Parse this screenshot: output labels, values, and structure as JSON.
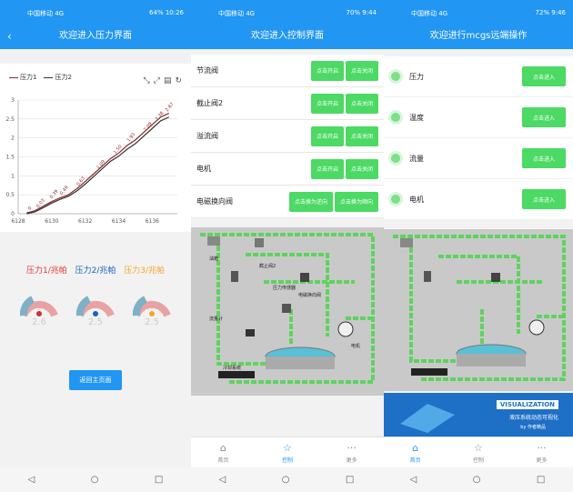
{
  "status": {
    "p1": {
      "left": "中国移动 4G",
      "right": "64% 10:26"
    },
    "p2": {
      "left": "中国移动 4G",
      "right": "70% 9:44"
    },
    "p3": {
      "left": "中国移动 4G",
      "right": "72% 9:46"
    }
  },
  "panel1": {
    "title": "欢迎进入压力界面",
    "legend": [
      "压力1",
      "压力2"
    ],
    "gauge_legend": [
      {
        "text": "压力1/兆帕",
        "color": "#e53935"
      },
      {
        "text": "压力2/兆帕",
        "color": "#1565c0"
      },
      {
        "text": "压力3/兆帕",
        "color": "#f5a623"
      }
    ],
    "gauge_values": [
      "2.6",
      "2.5",
      "2.5"
    ],
    "home_button": "返回主页面"
  },
  "chart_data": {
    "type": "line",
    "title": "",
    "xlabel": "",
    "ylabel": "",
    "xlim": [
      6128,
      6137.5
    ],
    "ylim": [
      0,
      3
    ],
    "x_ticks": [
      6128,
      6130,
      6132,
      6134,
      6136
    ],
    "y_ticks": [
      0,
      0.5,
      1,
      1.5,
      2,
      2.5,
      3
    ],
    "series": [
      {
        "name": "压力1",
        "color": "#8b2a2a",
        "x": [
          6128.5,
          6129,
          6129.5,
          6130,
          6130.5,
          6131,
          6131.5,
          6132,
          6132.5,
          6133,
          6133.5,
          6134,
          6134.5,
          6135,
          6135.5,
          6136,
          6136.5,
          6137
        ],
        "y": [
          0.02,
          0.08,
          0.2,
          0.32,
          0.42,
          0.5,
          0.66,
          0.85,
          1.05,
          1.25,
          1.45,
          1.6,
          1.8,
          1.95,
          2.15,
          2.35,
          2.55,
          2.65
        ]
      },
      {
        "name": "压力2",
        "color": "#333333",
        "x": [
          6128.5,
          6129,
          6129.5,
          6130,
          6130.5,
          6131,
          6131.5,
          6132,
          6132.5,
          6133,
          6133.5,
          6134,
          6134.5,
          6135,
          6135.5,
          6136,
          6136.5,
          6137
        ],
        "y": [
          0.0,
          0.05,
          0.16,
          0.28,
          0.38,
          0.46,
          0.6,
          0.78,
          0.98,
          1.18,
          1.38,
          1.52,
          1.7,
          1.85,
          2.05,
          2.25,
          2.45,
          2.55
        ]
      }
    ],
    "data_labels": [
      {
        "x": 6128.7,
        "y": 0.02,
        "text": "0"
      },
      {
        "x": 6129.2,
        "y": 0.08,
        "text": "0.03"
      },
      {
        "x": 6130,
        "y": 0.32,
        "text": "0.39"
      },
      {
        "x": 6130.6,
        "y": 0.42,
        "text": "0.49"
      },
      {
        "x": 6131.6,
        "y": 0.66,
        "text": "0.63"
      },
      {
        "x": 6132.8,
        "y": 1.1,
        "text": "1.09"
      },
      {
        "x": 6133.8,
        "y": 1.5,
        "text": "1.50"
      },
      {
        "x": 6134.6,
        "y": 1.82,
        "text": "1.93"
      },
      {
        "x": 6135.6,
        "y": 2.1,
        "text": "2.09"
      },
      {
        "x": 6136.3,
        "y": 2.38,
        "text": "2.38"
      },
      {
        "x": 6136.9,
        "y": 2.62,
        "text": "2.67"
      }
    ]
  },
  "panel2": {
    "title": "欢迎进入控制界面",
    "rows": [
      {
        "label": "节流阀",
        "buttons": [
          "点击开启",
          "点击关闭"
        ]
      },
      {
        "label": "截止阀2",
        "buttons": [
          "点击开启",
          "点击关闭"
        ]
      },
      {
        "label": "溢流阀",
        "buttons": [
          "点击开启",
          "点击关闭"
        ]
      },
      {
        "label": "电机",
        "buttons": [
          "点击开启",
          "点击关闭"
        ]
      },
      {
        "label": "电磁换向阀",
        "buttons": [
          "点击换为逆向",
          "点击换为顺向"
        ]
      }
    ],
    "tabs": [
      "首页",
      "控制",
      "更多"
    ]
  },
  "panel3": {
    "title": "欢迎进行mcgs远端操作",
    "rows": [
      {
        "label": "压力",
        "button": "点击进入"
      },
      {
        "label": "温度",
        "button": "点击进入"
      },
      {
        "label": "流量",
        "button": "点击进入"
      },
      {
        "label": "电机",
        "button": "点击进入"
      }
    ],
    "banner": {
      "title": "VISUALIZATION",
      "subtitle": "液压系统动态可视化",
      "maker": "by 作者精品"
    },
    "tabs": [
      "首页",
      "控制",
      "更多"
    ]
  },
  "process_labels": [
    "油箱",
    "截止阀2",
    "电磁换向阀",
    "压力传感器",
    "流量计",
    "电机",
    "冷却系统"
  ],
  "colors": {
    "accent": "#2196f3",
    "green": "#4cd964",
    "pipe": "#5ed35e"
  }
}
